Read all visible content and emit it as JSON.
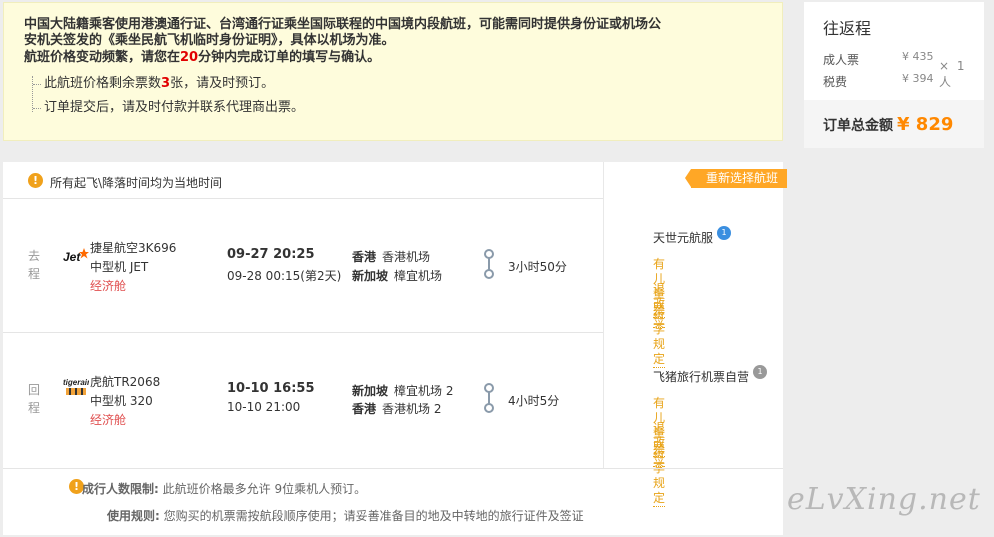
{
  "notice": {
    "warning_line1": "中国大陆籍乘客使用港澳通行证、台湾通行证乘坐国际联程的中国境内段航班，可能需同时提供身份证或机场公",
    "warning_line2": "安机关签发的《乘坐民航飞机临时身份证明》，具体以机场为准。",
    "warning_line3_pre": "航班价格变动频繁，请您在",
    "warning_line3_minutes": "20",
    "warning_line3_post": "分钟内完成订单的填写与确认。",
    "tip1_pre": "此航班价格剩余票数",
    "tip1_count": "3",
    "tip1_post": "张，请及时预订。",
    "tip2": "订单提交后，请及时付款并联系代理商出票。"
  },
  "summary": {
    "title": "往返程",
    "adult_label": "成人票",
    "adult_price": "¥ 435",
    "tax_label": "税费",
    "tax_price": "¥ 394",
    "multiplier": "× 1 人",
    "total_label": "订单总金额",
    "total_amount": "¥ 829"
  },
  "timebar": {
    "icon": "!",
    "text": "所有起飞\\降落时间均为当地时间"
  },
  "rechoose_label": "重新选择航班",
  "segments": [
    {
      "direction": [
        "去",
        "程"
      ],
      "logo": "jetstar-logo",
      "airline": "捷星航空3K696",
      "aircraft": "中型机 JET",
      "cabin": "经济舱",
      "dep_time": "09-27 20:25",
      "arr_time": "09-28 00:15(第2天)",
      "dep_city": "香港",
      "dep_airport": "香港机场",
      "arr_city": "新加坡",
      "arr_airport": "樟宜机场",
      "duration": "3小时50分",
      "agent": "天世元航服",
      "agent_badge": "1",
      "agent_badge_color": "#3b8fe0",
      "links": [
        "有儿童票",
        "退改签",
        "行李规定"
      ]
    },
    {
      "direction": [
        "回",
        "程"
      ],
      "logo": "tigerair-logo",
      "airline": "虎航TR2068",
      "aircraft": "中型机 320",
      "cabin": "经济舱",
      "dep_time": "10-10 16:55",
      "arr_time": "10-10 21:00",
      "dep_city": "新加坡",
      "dep_airport": "樟宜机场 2",
      "arr_city": "香港",
      "arr_airport": "香港机场 2",
      "duration": "4小时5分",
      "agent": "飞猪旅行机票自营",
      "agent_badge": "1",
      "agent_badge_color": "#999999",
      "links": [
        "有儿童票",
        "退改签",
        "行李规定"
      ]
    }
  ],
  "rules": {
    "limit_label": "成行人数限制:",
    "limit_text": "此航班价格最多允许 9位乘机人预订。",
    "usage_label": "使用规则:",
    "usage_text": "您购买的机票需按航段顺序使用；请妥善准备目的地及中转地的旅行证件及签证"
  },
  "watermark": "eLvXing.net",
  "colors": {
    "accent_orange": "#ff8800",
    "link_orange": "#e8a317",
    "alert_red": "#e10000",
    "cabin_red": "#e05050",
    "notice_bg": "#fefcdc"
  }
}
